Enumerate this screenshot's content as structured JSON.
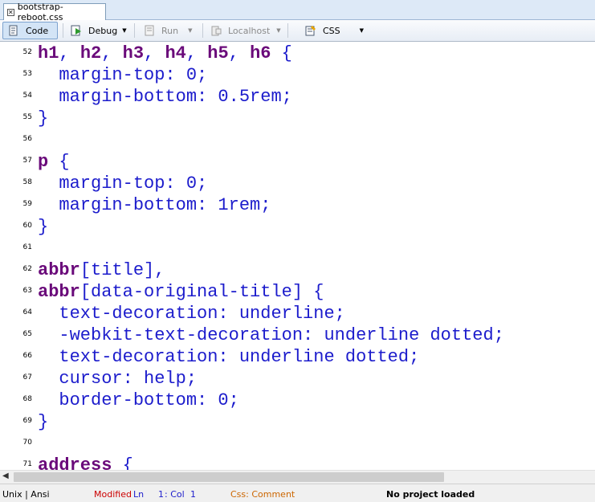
{
  "tab": {
    "title": "bootstrap-reboot.css",
    "close_glyph": "✕"
  },
  "toolbar": {
    "code_label": "Code",
    "debug_label": "Debug",
    "run_label": "Run",
    "localhost_label": "Localhost",
    "css_label": "CSS",
    "caret": "▼"
  },
  "editor": {
    "lines": [
      {
        "n": "52",
        "segs": [
          [
            "sel",
            "h1"
          ],
          [
            "pun",
            ", "
          ],
          [
            "sel",
            "h2"
          ],
          [
            "pun",
            ", "
          ],
          [
            "sel",
            "h3"
          ],
          [
            "pun",
            ", "
          ],
          [
            "sel",
            "h4"
          ],
          [
            "pun",
            ", "
          ],
          [
            "sel",
            "h5"
          ],
          [
            "pun",
            ", "
          ],
          [
            "sel",
            "h6"
          ],
          [
            "pun",
            " {"
          ]
        ]
      },
      {
        "n": "53",
        "segs": [
          [
            "pun",
            "  margin-top: 0;"
          ]
        ]
      },
      {
        "n": "54",
        "segs": [
          [
            "pun",
            "  margin-bottom: 0.5rem;"
          ]
        ]
      },
      {
        "n": "55",
        "segs": [
          [
            "pun",
            "}"
          ]
        ]
      },
      {
        "n": "56",
        "segs": []
      },
      {
        "n": "57",
        "segs": [
          [
            "sel",
            "p"
          ],
          [
            "pun",
            " {"
          ]
        ]
      },
      {
        "n": "58",
        "segs": [
          [
            "pun",
            "  margin-top: 0;"
          ]
        ]
      },
      {
        "n": "59",
        "segs": [
          [
            "pun",
            "  margin-bottom: 1rem;"
          ]
        ]
      },
      {
        "n": "60",
        "segs": [
          [
            "pun",
            "}"
          ]
        ]
      },
      {
        "n": "61",
        "segs": []
      },
      {
        "n": "62",
        "segs": [
          [
            "sel",
            "abbr"
          ],
          [
            "pun",
            "[title],"
          ]
        ]
      },
      {
        "n": "63",
        "segs": [
          [
            "sel",
            "abbr"
          ],
          [
            "pun",
            "[data-original-title] {"
          ]
        ]
      },
      {
        "n": "64",
        "segs": [
          [
            "pun",
            "  text-decoration: underline;"
          ]
        ]
      },
      {
        "n": "65",
        "segs": [
          [
            "pun",
            "  -webkit-text-decoration: underline dotted;"
          ]
        ]
      },
      {
        "n": "66",
        "segs": [
          [
            "pun",
            "  text-decoration: underline dotted;"
          ]
        ]
      },
      {
        "n": "67",
        "segs": [
          [
            "pun",
            "  cursor: help;"
          ]
        ]
      },
      {
        "n": "68",
        "segs": [
          [
            "pun",
            "  border-bottom: 0;"
          ]
        ]
      },
      {
        "n": "69",
        "segs": [
          [
            "pun",
            "}"
          ]
        ]
      },
      {
        "n": "70",
        "segs": []
      },
      {
        "n": "71",
        "segs": [
          [
            "sel",
            "address"
          ],
          [
            "pun",
            " {"
          ]
        ]
      }
    ]
  },
  "statusbar": {
    "line_endings": "Unix | Ansi",
    "modified": "Modified",
    "ln_label": "Ln",
    "ln_value": "1",
    "col_label": ": Col",
    "col_value": "1",
    "syntax": "Css: Comment",
    "project": "No project loaded"
  },
  "colors": {
    "selector": "#6a0a7a",
    "code_text": "#1c1ccc",
    "modified": "#cc0000",
    "syntax_status": "#cc6600",
    "ln_col_values": "#1c1ccc"
  },
  "icons": [
    "close-icon",
    "code-view-icon",
    "debug-icon",
    "run-icon",
    "localhost-icon",
    "css-file-icon",
    "scroll-left-arrow-icon"
  ]
}
